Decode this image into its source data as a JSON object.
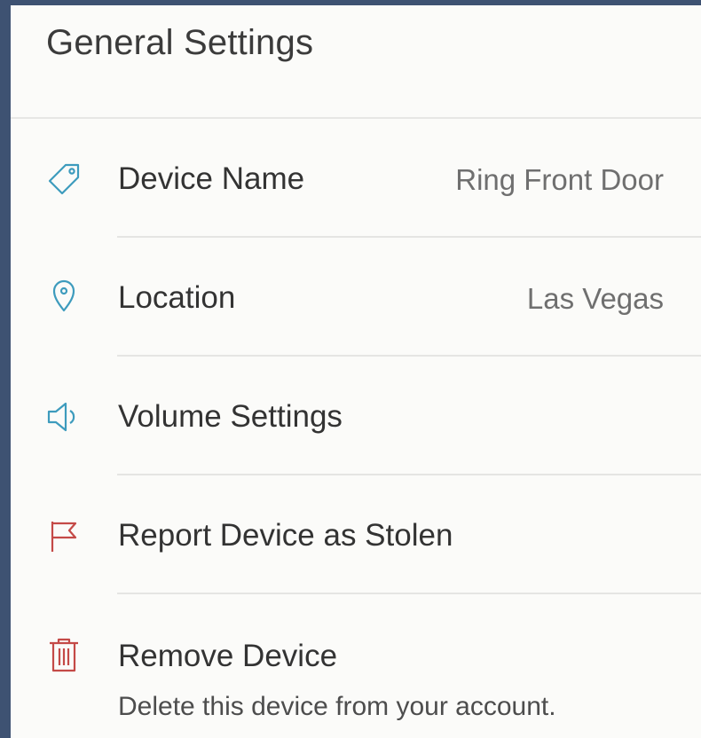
{
  "page": {
    "title": "General Settings"
  },
  "settings": {
    "items": [
      {
        "label": "Device Name",
        "value": "Ring Front Door",
        "icon": "tag-icon"
      },
      {
        "label": "Location",
        "value": "Las Vegas",
        "icon": "location-pin-icon"
      },
      {
        "label": "Volume Settings",
        "icon": "speaker-icon"
      },
      {
        "label": "Report Device as Stolen",
        "icon": "flag-icon"
      },
      {
        "label": "Remove Device",
        "description": "Delete this device from your account.",
        "icon": "trash-icon"
      }
    ]
  },
  "colors": {
    "icon_blue": "#3d9bbd",
    "icon_red": "#c44a47",
    "background": "#3e5272",
    "panel": "#fbfbf9"
  }
}
